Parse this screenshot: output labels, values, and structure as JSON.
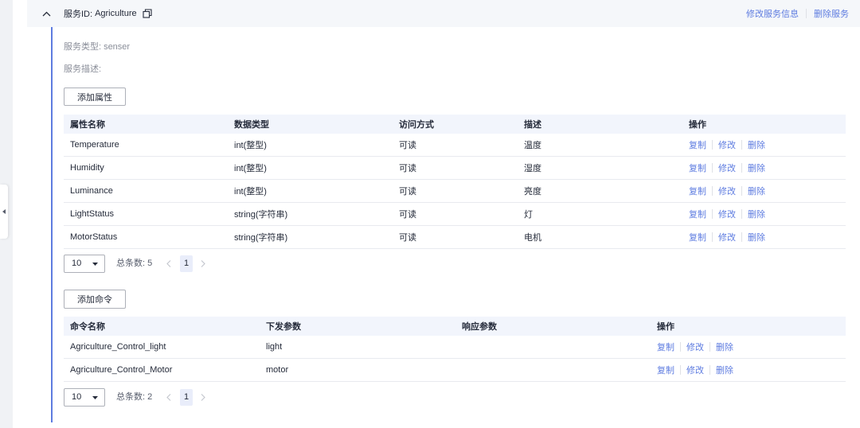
{
  "sidebar": {
    "toggle_icon": "caret-left-icon"
  },
  "service": {
    "collapse_icon": "chevron-up-icon",
    "id_label": "服务ID:",
    "id_value": "Agriculture",
    "copy_icon": "copy-icon",
    "edit_label": "修改服务信息",
    "delete_label": "删除服务",
    "type_label": "服务类型:",
    "type_value": "senser",
    "desc_label": "服务描述:"
  },
  "properties": {
    "add_label": "添加属性",
    "columns": [
      "属性名称",
      "数据类型",
      "访问方式",
      "描述",
      "操作"
    ],
    "rows": [
      {
        "name": "Temperature",
        "data_type": "int(整型)",
        "access": "可读",
        "description": "温度"
      },
      {
        "name": "Humidity",
        "data_type": "int(整型)",
        "access": "可读",
        "description": "湿度"
      },
      {
        "name": "Luminance",
        "data_type": "int(整型)",
        "access": "可读",
        "description": "亮度"
      },
      {
        "name": "LightStatus",
        "data_type": "string(字符串)",
        "access": "可读",
        "description": "灯"
      },
      {
        "name": "MotorStatus",
        "data_type": "string(字符串)",
        "access": "可读",
        "description": "电机"
      }
    ],
    "actions": [
      "复制",
      "修改",
      "删除"
    ],
    "pagination": {
      "page_size": "10",
      "dropdown_icon": "caret-down-icon",
      "total_label": "总条数:",
      "total": 5,
      "prev_icon": "chevron-left-icon",
      "current_page": 1,
      "next_icon": "chevron-right-icon"
    }
  },
  "commands": {
    "add_label": "添加命令",
    "columns": [
      "命令名称",
      "下发参数",
      "响应参数",
      "操作"
    ],
    "rows": [
      {
        "name": "Agriculture_Control_light",
        "command_params": "light"
      },
      {
        "name": "Agriculture_Control_Motor",
        "command_params": "motor"
      }
    ],
    "actions": [
      "复制",
      "修改",
      "删除"
    ],
    "pagination": {
      "page_size": "10",
      "dropdown_icon": "caret-down-icon",
      "total_label": "总条数:",
      "total": 2,
      "prev_icon": "chevron-left-icon",
      "current_page": 1,
      "next_icon": "chevron-right-icon"
    }
  },
  "colors": {
    "link": "#5e7ce0",
    "text": "#252b3a",
    "muted_text": "#8a8e99",
    "accent_line": "#5e7ce0",
    "header_background": "#f5f7fa",
    "table_header_background": "#f2f5fc",
    "current_page_background": "#e9edfa"
  }
}
